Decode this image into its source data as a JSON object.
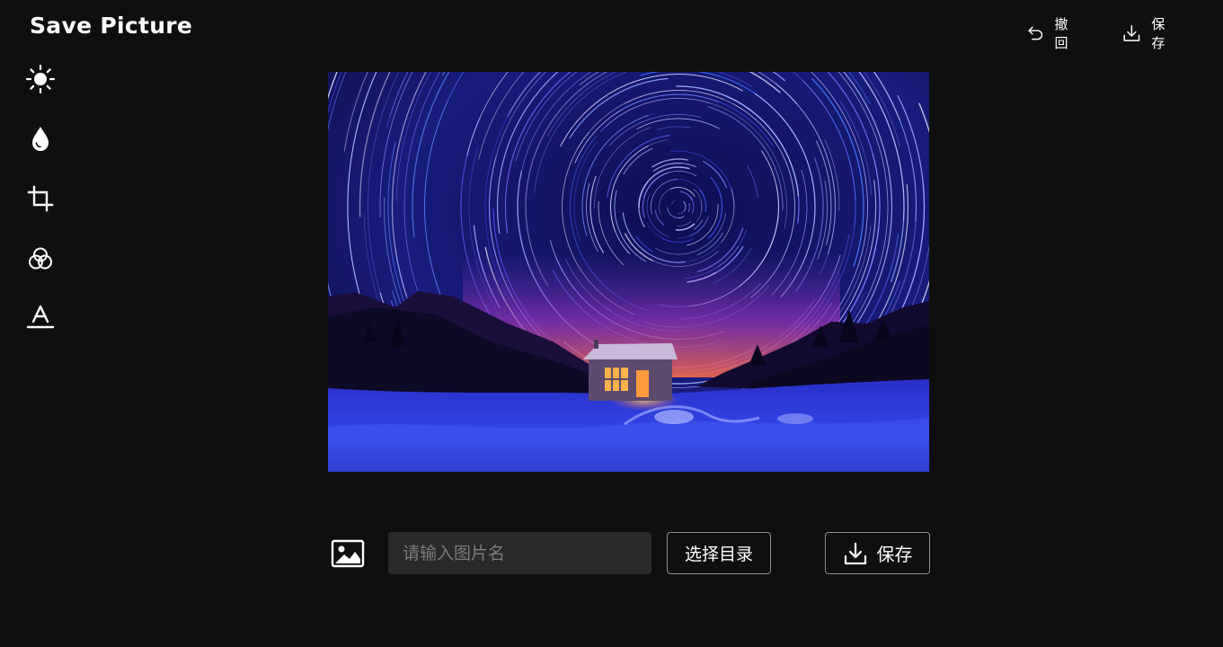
{
  "app": {
    "title": "Save Picture"
  },
  "toolbar": {
    "undo_label": "撤回",
    "save_label": "保存",
    "undo_icon": "undo-icon",
    "save_icon": "download-icon"
  },
  "sidebar": {
    "items": [
      {
        "name": "brightness",
        "icon": "sun-icon"
      },
      {
        "name": "saturation",
        "icon": "drop-icon"
      },
      {
        "name": "crop",
        "icon": "crop-icon"
      },
      {
        "name": "filter",
        "icon": "color-circles-icon"
      },
      {
        "name": "text",
        "icon": "text-icon"
      }
    ]
  },
  "canvas": {
    "image_alt": "star trails over snowy cabin at night"
  },
  "save_form": {
    "image_icon": "image-icon",
    "name_placeholder": "请输入图片名",
    "name_value": "",
    "choose_dir_label": "选择目录",
    "save_label": "保存"
  },
  "colors": {
    "background": "#0f0f0f",
    "input_bg": "#2a2a2a",
    "button_border": "#8c8c8c"
  }
}
